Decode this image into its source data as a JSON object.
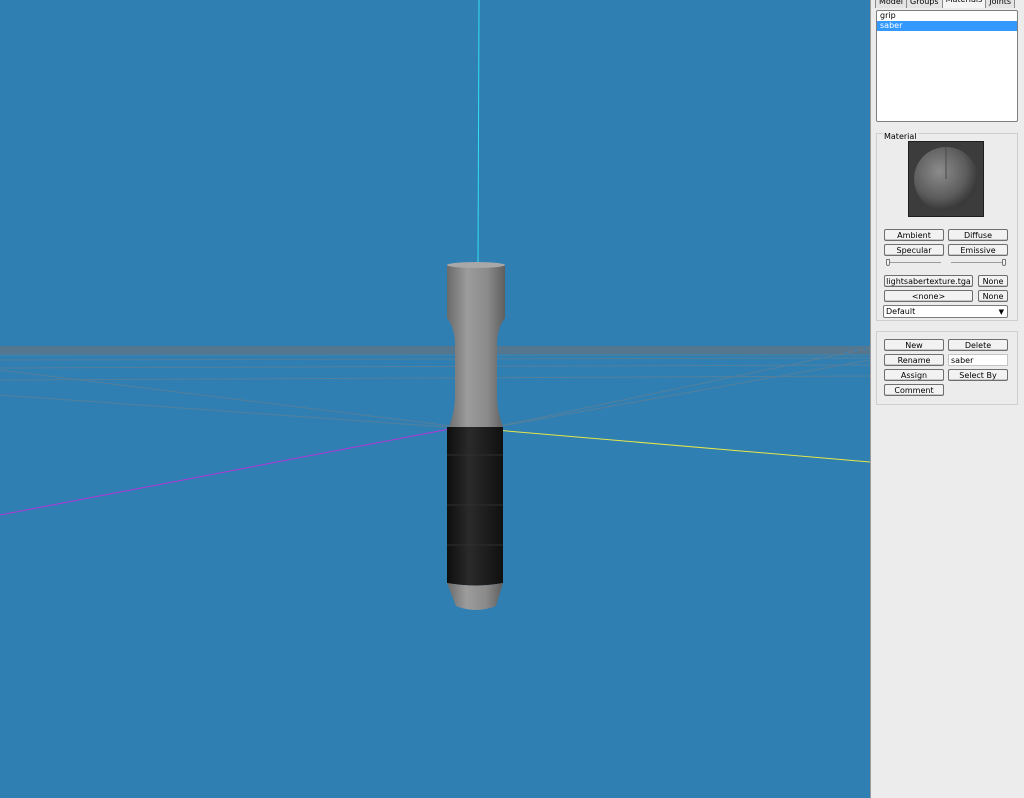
{
  "tabs": [
    {
      "label": "Model",
      "active": false
    },
    {
      "label": "Groups",
      "active": false
    },
    {
      "label": "Materials",
      "active": true
    },
    {
      "label": "Joints",
      "active": false
    }
  ],
  "material_list": [
    {
      "label": "grip",
      "selected": false
    },
    {
      "label": "saber",
      "selected": true
    }
  ],
  "material_group": {
    "title": "Material",
    "ambient": "Ambient",
    "diffuse": "Diffuse",
    "specular": "Specular",
    "emissive": "Emissive",
    "texture1": "lightsabertexture.tga",
    "texture1_clear": "None",
    "texture2": "<none>",
    "texture2_clear": "None",
    "blend_mode": "Default"
  },
  "actions": {
    "new": "New",
    "delete": "Delete",
    "rename": "Rename",
    "name_value": "saber",
    "assign": "Assign",
    "select_by": "Select By",
    "comment": "Comment"
  },
  "colors": {
    "viewport_bg": "#2f7fb3",
    "axis_y": "#33e0ee",
    "axis_x": "#e6e64a",
    "axis_z": "#b436d8",
    "grid": "#8c6a58",
    "handle_metal": "#8a8a8a",
    "grip_black": "#1c1c1c"
  },
  "viewport_label": "3D viewport"
}
